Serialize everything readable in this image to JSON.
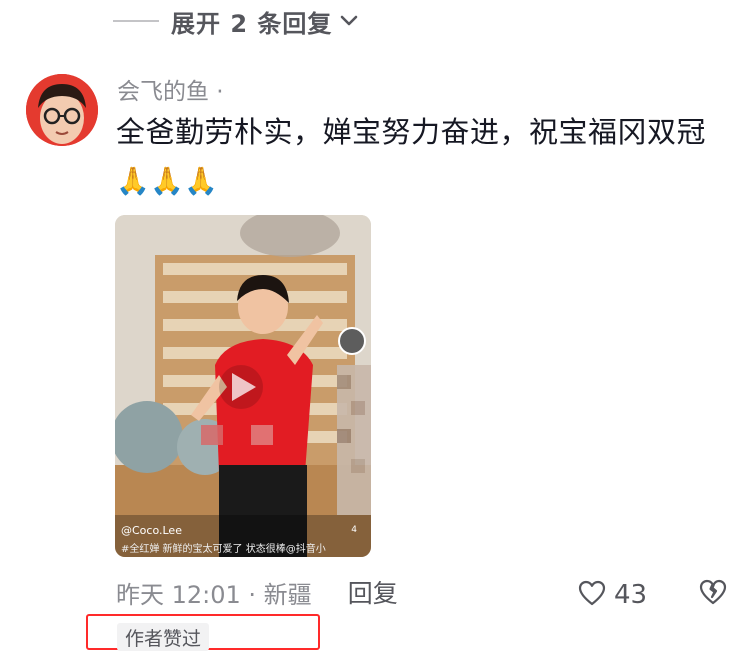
{
  "replies": {
    "expand_label": "展开 2 条回复"
  },
  "comment": {
    "username": "会飞的鱼 ·",
    "text": "全爸勤劳朴实，婵宝努力奋进，祝宝福冈双冠",
    "emojis": "🙏🙏🙏",
    "timestamp": "昨天 12:01 · 新疆",
    "reply_label": "回复",
    "like_count": "43",
    "author_liked_label": "作者赞过"
  },
  "video": {
    "handle": "@Coco.Lee",
    "caption": "#全红婵 新鲜的宝太可爱了 状态很棒@抖音小",
    "side_count": "4"
  },
  "icons": {
    "expand": "chevron-down-icon",
    "like": "heart-outline-icon",
    "dislike": "broken-heart-icon",
    "play": "play-icon"
  },
  "colors": {
    "highlight_frame": "#ff2a2a",
    "secondary_text": "#8a8b91",
    "jersey_red": "#e21c23"
  }
}
